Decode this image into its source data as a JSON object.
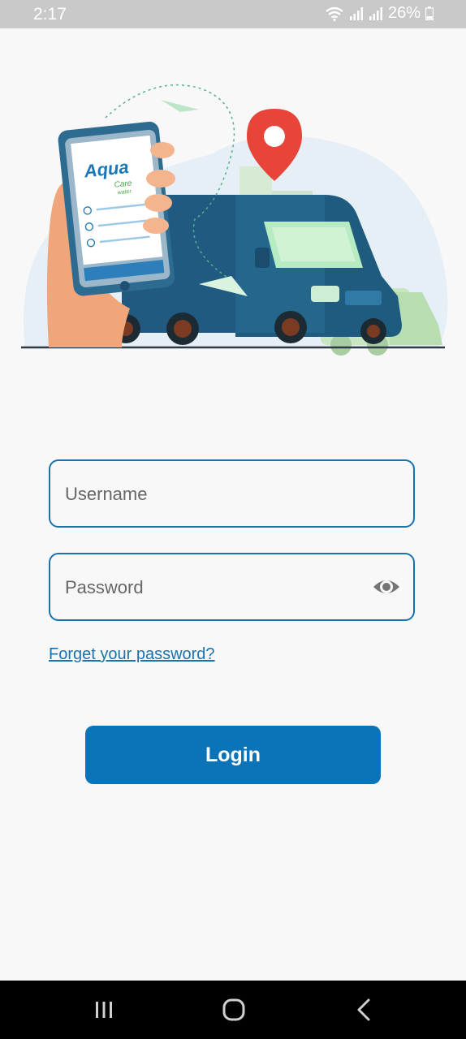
{
  "status_bar": {
    "time": "2:17",
    "battery": "26%"
  },
  "illustration": {
    "brand_name": "Aqua",
    "brand_sub": "Care",
    "brand_tag": "water"
  },
  "form": {
    "username_placeholder": "Username",
    "password_placeholder": "Password",
    "forgot_label": "Forget your password?",
    "login_label": "Login"
  },
  "colors": {
    "primary": "#0b74b9",
    "field_border": "#1a72ad",
    "pin": "#e8453a",
    "truck": "#1f5b7f"
  },
  "icons": {
    "visibility": "eye-icon",
    "nav_recents": "recents-icon",
    "nav_home": "home-icon",
    "nav_back": "back-icon"
  }
}
